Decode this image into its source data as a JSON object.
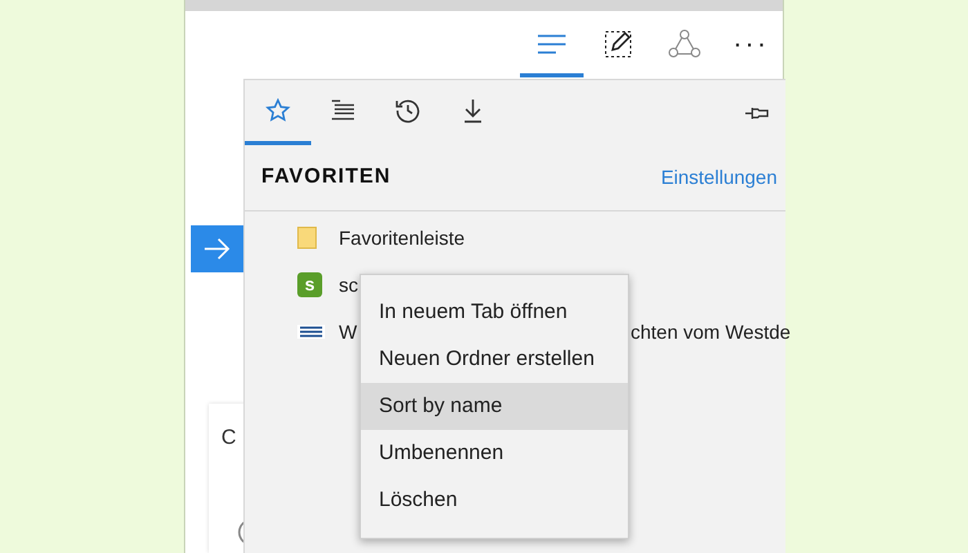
{
  "toolbar": {
    "buttons": [
      {
        "kind": "hub",
        "selected": true
      },
      {
        "kind": "note",
        "selected": false
      },
      {
        "kind": "share",
        "selected": false
      },
      {
        "kind": "more",
        "selected": false,
        "label": "···"
      }
    ]
  },
  "page": {
    "fragment": "C"
  },
  "hub_panel": {
    "tabs": [
      {
        "kind": "favorites",
        "selected": true
      },
      {
        "kind": "reading-list",
        "selected": false
      },
      {
        "kind": "history",
        "selected": false
      },
      {
        "kind": "downloads",
        "selected": false
      }
    ],
    "title": "FAVORITEN",
    "settings_link": "Einstellungen",
    "items": [
      {
        "kind": "folder",
        "label": "Favoritenleiste"
      },
      {
        "kind": "site-s",
        "logo": "s",
        "label": "sc"
      },
      {
        "kind": "site-wdr",
        "label": "W",
        "label_after_menu": "chten vom Westde"
      }
    ]
  },
  "context_menu": {
    "items": [
      {
        "label": "In neuem Tab öffnen",
        "selected": false
      },
      {
        "label": "Neuen Ordner erstellen",
        "selected": false
      },
      {
        "label": "Sort by name",
        "selected": true
      },
      {
        "label": "Umbenennen",
        "selected": false
      },
      {
        "label": "Löschen",
        "selected": false
      }
    ]
  }
}
